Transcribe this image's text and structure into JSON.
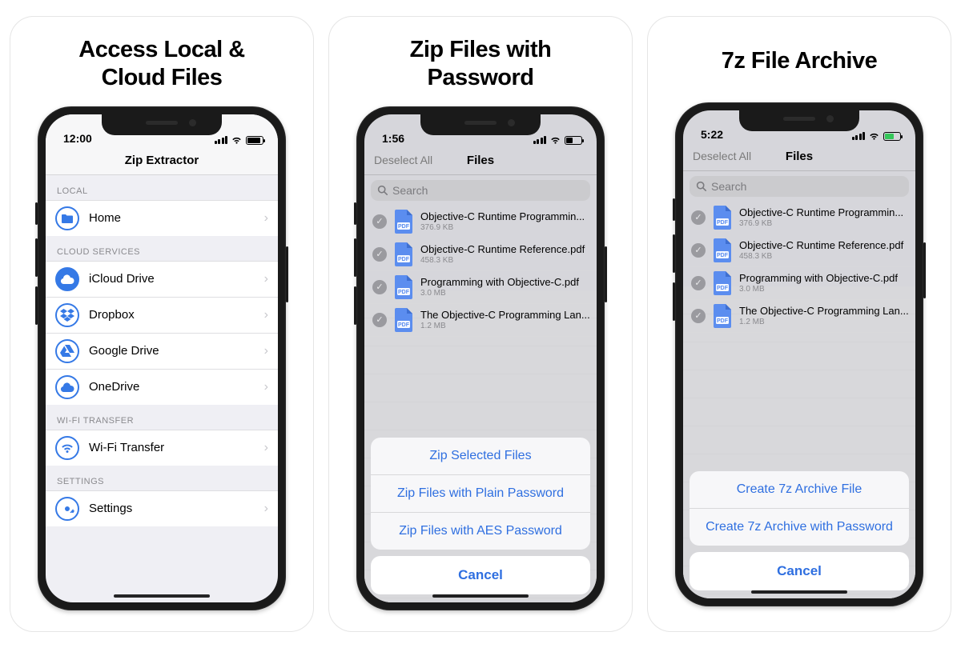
{
  "panels": [
    {
      "title": "Access Local &\nCloud Files"
    },
    {
      "title": "Zip Files with\nPassword"
    },
    {
      "title": "7z File Archive"
    }
  ],
  "phone1": {
    "time": "12:00",
    "nav_title": "Zip Extractor",
    "sections": {
      "local_header": "LOCAL",
      "cloud_header": "CLOUD SERVICES",
      "wifi_header": "WI-FI TRANSFER",
      "settings_header": "SETTINGS"
    },
    "rows": {
      "home": "Home",
      "icloud": "iCloud Drive",
      "dropbox": "Dropbox",
      "gdrive": "Google Drive",
      "onedrive": "OneDrive",
      "wifi": "Wi-Fi Transfer",
      "settings": "Settings"
    }
  },
  "phone2": {
    "time": "1:56",
    "deselect": "Deselect All",
    "nav_title": "Files",
    "search_placeholder": "Search",
    "files": [
      {
        "name": "Objective-C Runtime Programmin...",
        "size": "376.9 KB"
      },
      {
        "name": "Objective-C Runtime Reference.pdf",
        "size": "458.3 KB"
      },
      {
        "name": "Programming with Objective-C.pdf",
        "size": "3.0 MB"
      },
      {
        "name": "The Objective-C Programming Lan...",
        "size": "1.2 MB"
      }
    ],
    "sheet": {
      "opt1": "Zip Selected Files",
      "opt2": "Zip Files with Plain Password",
      "opt3": "Zip Files with AES Password",
      "cancel": "Cancel"
    }
  },
  "phone3": {
    "time": "5:22",
    "deselect": "Deselect All",
    "nav_title": "Files",
    "search_placeholder": "Search",
    "files": [
      {
        "name": "Objective-C Runtime Programmin...",
        "size": "376.9 KB"
      },
      {
        "name": "Objective-C Runtime Reference.pdf",
        "size": "458.3 KB"
      },
      {
        "name": "Programming with Objective-C.pdf",
        "size": "3.0 MB"
      },
      {
        "name": "The Objective-C Programming Lan...",
        "size": "1.2 MB"
      }
    ],
    "sheet": {
      "opt1": "Create 7z Archive File",
      "opt2": "Create 7z Archive with Password",
      "cancel": "Cancel"
    }
  }
}
